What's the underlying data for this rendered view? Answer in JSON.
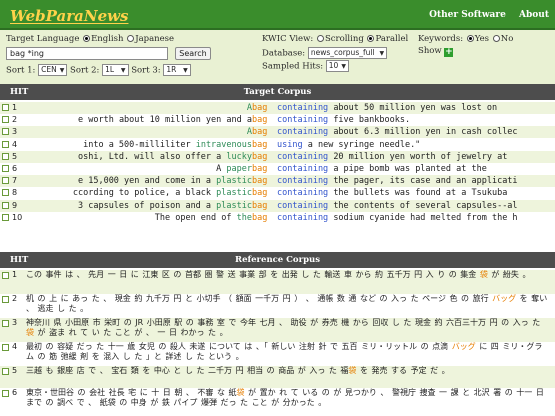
{
  "header": {
    "logo": "WebParaNews",
    "nav": [
      "Other Software",
      "About"
    ]
  },
  "controls": {
    "target_language_label": "Target Language",
    "lang_english": "English",
    "lang_japanese": "Japanese",
    "lang_selected": "English",
    "search_value": "bag *ing",
    "search_button": "Search",
    "sort1_label": "Sort 1:",
    "sort1_value": "CEN",
    "sort2_label": "Sort 2:",
    "sort2_value": "1L",
    "sort3_label": "Sort 3:",
    "sort3_value": "1R",
    "kwic_label": "KWIC View:",
    "kwic_scrolling": "Scrolling",
    "kwic_parallel": "Parallel",
    "kwic_selected": "Parallel",
    "database_label": "Database:",
    "database_value": "news_corpus_full",
    "sampled_label": "Sampled Hits:",
    "sampled_value": "10",
    "keywords_label": "Keywords:",
    "kw_yes": "Yes",
    "kw_no": "No",
    "kw_selected": "Yes",
    "show_label": "Show"
  },
  "target": {
    "hit_label": "HIT",
    "title": "Target Corpus",
    "rows": [
      {
        "n": "1",
        "left": "",
        "pre": "A",
        "kw": "bag",
        "hit": "containing",
        "post": "",
        "right": "about 50 million yen was lost on"
      },
      {
        "n": "2",
        "left": "e worth about 10 million yen and a",
        "pre": "",
        "kw": "bag",
        "hit": "containing",
        "post": "",
        "right": "five bankbooks."
      },
      {
        "n": "3",
        "left": "",
        "pre": "A",
        "kw": "bag",
        "hit": "containing",
        "post": "",
        "right": "about 6.3 million yen in cash collec"
      },
      {
        "n": "4",
        "left": "into a 500-milliliter",
        "pre": "intravenous",
        "kw": "bag",
        "hit": "using",
        "post": "",
        "right": "a new syringe needle.\""
      },
      {
        "n": "5",
        "left": "oshi, Ltd. will also offer a",
        "pre": "lucky",
        "kw": "bag",
        "hit": "containing",
        "post": "",
        "right": "20 million yen worth of jewelry at"
      },
      {
        "n": "6",
        "left": "A",
        "pre": "paper",
        "kw": "bag",
        "hit": "containing",
        "post": "",
        "right": "a pipe bomb was planted at the"
      },
      {
        "n": "7",
        "left": "e 15,000 yen and come in a",
        "pre": "plastic",
        "kw": "bag",
        "hit": "containing",
        "post": "",
        "right": "the pager, its case and an applicati"
      },
      {
        "n": "8",
        "left": "ccording to police, a black",
        "pre": "plastic",
        "kw": "bag",
        "hit": "containing",
        "post": "",
        "right": "the bullets was found at a Tsukuba"
      },
      {
        "n": "9",
        "left": "3 capsules of poison and a",
        "pre": "plastic",
        "kw": "bag",
        "hit": "containing",
        "post": "",
        "right": "the contents of several capsules--al"
      },
      {
        "n": "10",
        "left": "The open end of",
        "pre": "the",
        "kw": "bag",
        "hit": "containing",
        "post": "",
        "right": "sodium cyanide had melted from the h"
      }
    ]
  },
  "reference": {
    "hit_label": "HIT",
    "title": "Reference Corpus",
    "rows": [
      {
        "n": "1",
        "a": "この 事件 は 、 先月 一 日 に 江東 区 の 首都 圏 警 送 事業 部 を 出発 し た 輸送 車 から 約 五千万 円 入 り の 集金 ",
        "k": "袋",
        "b": " が 紛失 。"
      },
      {
        "n": "2",
        "a": "机 の 上 に あっ た 、 現金 約 九千万 円 と 小切手 （ 額面 一千万 円 ） 、 通帳 数 通 など の 入っ た ページ 色 の 旅行 ",
        "k": "バッグ",
        "b": " を 奪い 、 逃走 し た 。"
      },
      {
        "n": "3",
        "a": "神奈川 県 小田原 市 栄町 の JR 小田原 駅 の 事務 室 で 今年 七月 、 助役 が 券売 機 から 回収 し た 現金 約 六百三十万 円 の 入っ た ",
        "k": "袋",
        "b": " が 盗ま れ て い た こと が 、 一 日 わかっ た 。"
      },
      {
        "n": "4",
        "a": "最初 の 容疑 だっ た 十一 歳 女児 の 殺人 未遂 について は 、「 新しい 注射 針 で 五百 ミリ・リットル の 点滴 ",
        "k": "バッグ",
        "b": " に 四 ミリ・グラム の 筋 弛緩 剤 を 混入 し た 」と 詳述 し た という 。"
      },
      {
        "n": "5",
        "a": "三越 も 銀座 店 で 、 宝石 類 を 中心 と し た 二千万 円 相当 の 商品 が 入っ た 福",
        "k": "袋",
        "b": " を 発売 する 予定 だ 。"
      },
      {
        "n": "6",
        "a": "東京・世田谷 の 会社 社長 宅 に 十 日 朝 、 不審 な 紙",
        "k": "袋",
        "b": " が 置か れ て いる の が 見つかり 、 警視庁 捜査 一 課 と 北沢 署 の 十一 日 まで の 調べ で 、 紙袋 の 中身 が 鉄 パイプ 爆弾 だっ た こと が 分かった 。"
      }
    ]
  }
}
